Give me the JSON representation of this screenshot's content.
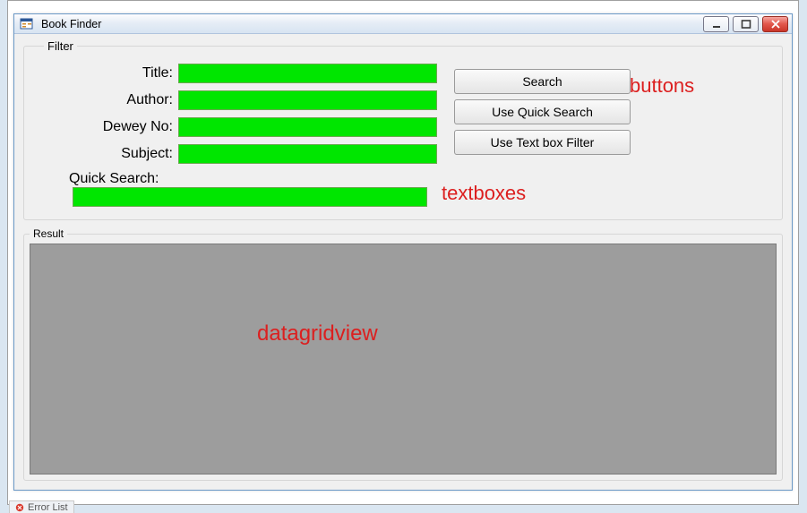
{
  "window": {
    "title": "Book Finder"
  },
  "filter": {
    "legend": "Filter",
    "title_label": "Title:",
    "author_label": "Author:",
    "dewey_label": "Dewey No:",
    "subject_label": "Subject:",
    "quick_label": "Quick Search:",
    "title_value": "",
    "author_value": "",
    "dewey_value": "",
    "subject_value": "",
    "quick_value": ""
  },
  "buttons": {
    "search": "Search",
    "quick": "Use Quick Search",
    "textfilter": "Use Text box Filter"
  },
  "result": {
    "legend": "Result"
  },
  "annotations": {
    "buttons": "buttons",
    "textboxes": "textboxes",
    "datagridview": "datagridview"
  },
  "bottom_tab": {
    "label": "Error List"
  },
  "colors": {
    "textbox_bg": "#00e600",
    "annotation": "#dc1f1f",
    "dgv_bg": "#9d9d9d"
  }
}
